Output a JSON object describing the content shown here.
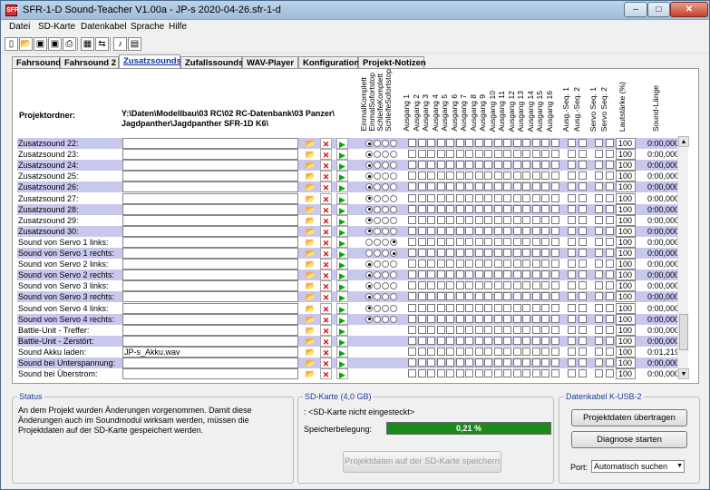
{
  "window": {
    "title": "SFR-1-D Sound-Teacher V1.00a - JP-s 2020-04-26.sfr-1-d",
    "min": "–",
    "max": "□",
    "close": "✕"
  },
  "menu": [
    "Datei",
    "SD-Karte",
    "Datenkabel",
    "Sprache",
    "Hilfe"
  ],
  "toolbar": [
    {
      "icon": "new-icon",
      "g": "▯"
    },
    {
      "icon": "open-icon",
      "g": "📂"
    },
    {
      "icon": "save-icon",
      "g": "▣"
    },
    {
      "icon": "save-red-icon",
      "g": "▣"
    },
    {
      "icon": "print-icon",
      "g": "⎙"
    },
    {
      "icon": "cards-icon",
      "g": "▦"
    },
    {
      "icon": "network-icon",
      "g": "⇆"
    },
    {
      "icon": "note-icon",
      "g": "♪"
    },
    {
      "icon": "pdf-icon",
      "g": "▤"
    }
  ],
  "tabs": [
    "Fahrsound",
    "Fahrsound 2",
    "Zusatzsounds",
    "Zufallssounds",
    "WAV-Player",
    "Konfiguration",
    "Projekt-Notizen"
  ],
  "active_tab": 2,
  "project": {
    "label": "Projektordner:",
    "path_line1": "Y:\\Daten\\Modellbau\\03 RC\\02 RC-Datenbank\\03 Panzer\\",
    "path_line2": "Jagdpanther\\Jagdpanther SFR-1D K6\\"
  },
  "columns": {
    "modes": [
      "EinmalKomplett",
      "EinmalSofortstop",
      "SchleifeKomplett",
      "SchleifeSofortstop"
    ],
    "outputs": [
      "Ausgang 1",
      "Ausgang 2",
      "Ausgang 3",
      "Ausgang 4",
      "Ausgang 5",
      "Ausgang 6",
      "Ausgang 7",
      "Ausgang 8",
      "Ausgang 9",
      "Ausgang 10",
      "Ausgang 11",
      "Ausgang 12",
      "Ausgang 13",
      "Ausgang 14",
      "Ausgang 15",
      "Ausgang 16"
    ],
    "seq": [
      "Ausg.-Seq. 1",
      "Ausg.-Seq. 2"
    ],
    "servo": [
      "Servo Seq. 1",
      "Servo Seq. 2"
    ],
    "volume": "Lautstärke (%)",
    "length": "Sound-Länge"
  },
  "rows": [
    {
      "label": "Zusatzsound 22:",
      "file": "",
      "mode": 0,
      "vol": "100",
      "len": "0:00,000"
    },
    {
      "label": "Zusatzsound 23:",
      "file": "",
      "mode": 0,
      "vol": "100",
      "len": "0:00,000"
    },
    {
      "label": "Zusatzsound 24:",
      "file": "",
      "mode": 0,
      "vol": "100",
      "len": "0:00,000"
    },
    {
      "label": "Zusatzsound 25:",
      "file": "",
      "mode": 0,
      "vol": "100",
      "len": "0:00,000"
    },
    {
      "label": "Zusatzsound 26:",
      "file": "",
      "mode": 0,
      "vol": "100",
      "len": "0:00,000"
    },
    {
      "label": "Zusatzsound 27:",
      "file": "",
      "mode": 0,
      "vol": "100",
      "len": "0:00,000"
    },
    {
      "label": "Zusatzsound 28:",
      "file": "",
      "mode": 0,
      "vol": "100",
      "len": "0:00,000"
    },
    {
      "label": "Zusatzsound 29:",
      "file": "",
      "mode": 0,
      "vol": "100",
      "len": "0:00,000"
    },
    {
      "label": "Zusatzsound 30:",
      "file": "",
      "mode": 0,
      "vol": "100",
      "len": "0:00,000"
    },
    {
      "label": "Sound von Servo 1 links:",
      "file": "",
      "mode": 3,
      "vol": "100",
      "len": "0:00,000"
    },
    {
      "label": "Sound von Servo 1 rechts:",
      "file": "",
      "mode": 3,
      "vol": "100",
      "len": "0:00,000"
    },
    {
      "label": "Sound von Servo 2 links:",
      "file": "",
      "mode": 0,
      "vol": "100",
      "len": "0:00,000"
    },
    {
      "label": "Sound von Servo 2 rechts:",
      "file": "",
      "mode": 0,
      "vol": "100",
      "len": "0:00,000"
    },
    {
      "label": "Sound von Servo 3 links:",
      "file": "",
      "mode": 0,
      "vol": "100",
      "len": "0:00,000"
    },
    {
      "label": "Sound von Servo 3 rechts:",
      "file": "",
      "mode": 0,
      "vol": "100",
      "len": "0:00,000"
    },
    {
      "label": "Sound von Servo 4 links:",
      "file": "",
      "mode": 0,
      "vol": "100",
      "len": "0:00,000"
    },
    {
      "label": "Sound von Servo 4 rechts:",
      "file": "",
      "mode": 0,
      "vol": "100",
      "len": "0:00,000"
    },
    {
      "label": "Battle-Unit - Treffer:",
      "file": "",
      "mode": -1,
      "vol": "100",
      "len": "0:00,000"
    },
    {
      "label": "Battle-Unit - Zerstört:",
      "file": "",
      "mode": -1,
      "vol": "100",
      "len": "0:00,000"
    },
    {
      "label": "Sound Akku laden:",
      "file": "JP-s_Akku.wav",
      "mode": -1,
      "vol": "100",
      "len": "0:01,219"
    },
    {
      "label": "Sound bei Unterspannung:",
      "file": "",
      "mode": -1,
      "vol": "100",
      "len": "0:00,000"
    },
    {
      "label": "Sound bei Überstrom:",
      "file": "",
      "mode": -1,
      "vol": "100",
      "len": "0:00,000"
    }
  ],
  "status": {
    "title": "Status",
    "text": "An dem Projekt wurden Änderungen vorgenommen. Damit diese Änderungen auch im Soundmodul wirksam werden, müssen die Projektdaten auf der SD-Karte gespeichert werden."
  },
  "sd": {
    "title": "SD-Karte (4,0 GB)",
    "line1": ": <SD-Karte nicht eingesteckt>",
    "mem_label": "Speicherbelegung:",
    "pct": "0,21 %",
    "fill": 0.0021,
    "save_button": "Projektdaten auf der SD-Karte speichern"
  },
  "cable": {
    "title": "Datenkabel K-USB-2",
    "btn_transfer": "Projektdaten übertragen",
    "btn_diag": "Diagnose starten",
    "port_label": "Port:",
    "port_value": "Automatisch suchen"
  },
  "colors": {
    "row_highlight": "#c8c8ec",
    "accent": "#1a3fa0",
    "progress": "#1a8a1a"
  }
}
